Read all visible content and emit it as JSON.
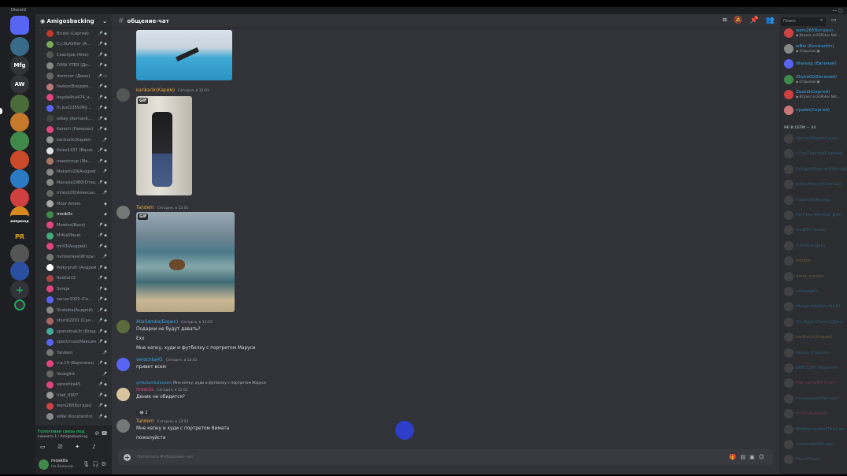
{
  "app": {
    "title": "Discord"
  },
  "window": {
    "controls": "— ◻"
  },
  "servers": [
    {
      "label": "",
      "color": "#5865f2",
      "kind": "home"
    },
    {
      "label": "",
      "color": "#3a6a8a"
    },
    {
      "label": "Mfg",
      "color": "#313338"
    },
    {
      "label": "AW",
      "color": "#313338"
    },
    {
      "label": "",
      "color": "#4a6b3a",
      "badge": true
    },
    {
      "label": "",
      "color": "#c47a2a"
    },
    {
      "label": "",
      "color": "#3f8a4a"
    },
    {
      "label": "",
      "color": "#c94a2a"
    },
    {
      "label": "",
      "color": "#2a7ac4"
    },
    {
      "label": "",
      "color": "#d04040"
    },
    {
      "label": "",
      "color": "#d88a20"
    },
    {
      "label": "ремприходи",
      "color": "#1e1f22"
    },
    {
      "label": "PR",
      "color": "#1e1f22"
    },
    {
      "label": "",
      "color": "#555"
    },
    {
      "label": "",
      "color": "#2a4fa0"
    },
    {
      "label": "+",
      "color": "#313338"
    },
    {
      "label": "",
      "color": "#313338"
    }
  ],
  "guild": {
    "name": "Amigosbacking",
    "dropdown_icon": "chevron-down-icon"
  },
  "voice_members": [
    {
      "name": "Brutel (Сергей)",
      "color": "#c0392b",
      "icons": "🎤̸ ◆"
    },
    {
      "name": "C.J.SLASHer (А...",
      "color": "#7a5",
      "icons": "🎤̸ ◆"
    },
    {
      "name": "Coachjoe (Alex)",
      "color": "#555",
      "icons": "🎤̸ ◆"
    },
    {
      "name": "DIMA YTER (Дн...",
      "color": "#888",
      "icons": "🎤̸ ◆"
    },
    {
      "name": "dremner (Дима)",
      "color": "#666",
      "icons": "🎤̸ ▭"
    },
    {
      "name": "favkov(Владим...",
      "color": "#b77",
      "icons": "🎤̸ ◆"
    },
    {
      "name": "heyda4hu474_a...",
      "color": "#e0457b",
      "icons": "🎤̸ ◆"
    },
    {
      "name": "Ih.Just2355(Му...",
      "color": "#5865f2",
      "icons": "🎤̸ ◆"
    },
    {
      "name": "izikey (RomanK...",
      "color": "#444",
      "icons": "🎤̸ ◆"
    },
    {
      "name": "Karach (Рамазан)",
      "color": "#e0457b",
      "icons": "🎤̸ ◆"
    },
    {
      "name": "karikarik(Карим)",
      "color": "#999",
      "icons": "🎤̸"
    },
    {
      "name": "Koles1437 (Ваня)",
      "color": "#e0e0e0",
      "icons": "🎤̸ ◆"
    },
    {
      "name": "maestroup (Ма...",
      "color": "#a76",
      "icons": "🎤̸ ◆"
    },
    {
      "name": "Makario29(Андрей)",
      "color": "#888",
      "icons": "🎤̸"
    },
    {
      "name": "Marusia1980(Отец)",
      "color": "#888",
      "icons": "🎤̸ ◆"
    },
    {
      "name": "miles100(Алексан...",
      "color": "#666",
      "icons": "🎤̸"
    },
    {
      "name": "Moor Artem",
      "color": "#aaa",
      "icons": "◆"
    },
    {
      "name": "mosk0s",
      "color": "#3f8a4a",
      "icons": "◆",
      "active": true
    },
    {
      "name": "Mowins(Вася)",
      "color": "#e0457b",
      "icons": "🎤̸ ◆"
    },
    {
      "name": "MrKu(Илья)",
      "color": "#4a7",
      "icons": "🎤̸ ◆"
    },
    {
      "name": "mr43(Андрей)",
      "color": "#e0457b",
      "icons": "🎤̸ ◆"
    },
    {
      "name": "nuniserase(Игорь)",
      "color": "#777",
      "icons": "🎤̸"
    },
    {
      "name": "Polkygrutt (Андрей)",
      "color": "#fff",
      "icons": "🎤̸ ◆"
    },
    {
      "name": "Redilani3",
      "color": "#a44",
      "icons": "🎤̸ ◆"
    },
    {
      "name": "Seroja",
      "color": "#e0457b",
      "icons": "🎤̸ ◆"
    },
    {
      "name": "server1000 (Се...",
      "color": "#5865f2",
      "icons": "🎤̸ ◆"
    },
    {
      "name": "Shatoba(Андрей)",
      "color": "#888",
      "icons": "🎤̸ ◆"
    },
    {
      "name": "shurik2201 (Сан...",
      "color": "#a66",
      "icons": "🎤̸ ◆"
    },
    {
      "name": "spanemak3r (Влад...",
      "color": "#4a9",
      "icons": "🎤̸ ◆"
    },
    {
      "name": "spectrmas(Максим)",
      "color": "#5865f2",
      "icons": "🎤̸ ◆"
    },
    {
      "name": "Tandem",
      "color": "#777",
      "icons": "🎤̸"
    },
    {
      "name": "v.a.19 (Вероника)",
      "color": "#e0457b",
      "icons": "🎤̸ ◆"
    },
    {
      "name": "Vazeglist",
      "color": "#666",
      "icons": "🎤̸"
    },
    {
      "name": "verochka45",
      "color": "#e0457b",
      "icons": "🎤̸ ◆"
    },
    {
      "name": "Vlad_9907",
      "color": "#999",
      "icons": "🎤̸ ◆"
    },
    {
      "name": "wers26f(Богдан)",
      "color": "#c44",
      "icons": "🎤̸ ◆"
    },
    {
      "name": "wNw (Konstantin)",
      "color": "#888",
      "icons": "🎤̸ ◆"
    }
  ],
  "voice_panel": {
    "status": "Голосовая связь под",
    "location": "комната 1 / Amigosbacking"
  },
  "user_panel": {
    "name": "mosk0s",
    "status": "На Великой..."
  },
  "channel": {
    "name": "общение-чат"
  },
  "messages": [
    {
      "author": "karikarik(Карим)",
      "author_color": "#e6a93d",
      "time": "Сегодня, в 12:01",
      "gif": true
    },
    {
      "author": "Tandem",
      "author_color": "#e6a93d",
      "time": "Сегодня, в 12:01",
      "gif": true
    },
    {
      "author": "AllaSamka(Борис)",
      "author_color": "#3ba5e4",
      "time": "Сегодня, в 12:02",
      "lines": [
        "Подарки не будут давать?",
        "Exx",
        "Мне кепку, худи и футболку с портретом Маруси"
      ]
    },
    {
      "author": "verochka45",
      "author_color": "#3ba5e4",
      "time": "Сегодня, в 12:02",
      "lines": [
        "привет всем"
      ]
    },
    {
      "reply_to": "@AllaSamka(Борис)",
      "reply_text": "Мне кепку, худи и футболку с портретом Маруси",
      "author": "mosk0s",
      "author_color": "#e0457b",
      "time": "Сегодня, в 12:02",
      "lines": [
        "Деник не обидится?"
      ],
      "reaction": "😂 2"
    },
    {
      "author": "Tandem",
      "author_color": "#e6a93d",
      "time": "Сегодня, в 12:03",
      "lines": [
        "Мне кепку и худи с портретом Вимата",
        "пожалуйста"
      ]
    }
  ],
  "gif_label": "GIF",
  "input": {
    "placeholder": "Написать #общение-чат"
  },
  "search": {
    "placeholder": "Поиск"
  },
  "online_members": [
    {
      "name": "wers26f(Богдан)",
      "sub": "◆ Играет в GGPoker Net...",
      "color": "#3ba5e4",
      "av": "#c44"
    },
    {
      "name": "wNw (Konstantin)",
      "sub": "◆ Отдыхаю ▣",
      "color": "#3ba5e4",
      "av": "#888"
    },
    {
      "name": "Ww/exp (Евгений)",
      "sub": "",
      "color": "#3ba5e4",
      "av": "#5865f2"
    },
    {
      "name": "Zbyka00(Евгений)",
      "sub": "◆ Отдыхаю ▣",
      "color": "#3ba5e4",
      "av": "#3f8a4a"
    },
    {
      "name": "Zezeal(Сергей)",
      "sub": "◆ Играет в GGPoker Net...",
      "color": "#3ba5e4",
      "av": "#d04040"
    },
    {
      "name": "прайм(Сергей)",
      "sub": "",
      "color": "#3ba5e4",
      "av": "#c77"
    }
  ],
  "offline_header": "НЕ В СЕТИ — 33",
  "offline_members": [
    {
      "name": "Bjecar(Мерп(Саша)",
      "color": "#3ba5e4"
    },
    {
      "name": "c7ra(Сергей(Сергей)",
      "color": "#3ba5e4"
    },
    {
      "name": "Jishgpd(Вартаr)(Артур)",
      "color": "#3ba5e4"
    },
    {
      "name": "jekto(Ника)(Сергей)",
      "color": "#3ba5e4"
    },
    {
      "name": "Kogal(К)(Кезар)",
      "color": "#3ba5e4"
    },
    {
      "name": "FinT-the Kei-KLG ДХС",
      "color": "#3ba5e4"
    },
    {
      "name": "chuEP(Сaсма)",
      "color": "#3ba5e4"
    },
    {
      "name": "Candice(Дзе)",
      "color": "#3ba5e4"
    },
    {
      "name": "Denbik",
      "color": "#e6a93d"
    },
    {
      "name": "dima_money",
      "color": "#e6a93d"
    },
    {
      "name": "ar(hubgk)",
      "color": "#3ba5e4"
    },
    {
      "name": "Hungrubb(Kyrylo)(Ю",
      "color": "#3ba5e4"
    },
    {
      "name": "IYv(Aapr)(Тимо)(Деш",
      "color": "#3ba5e4"
    },
    {
      "name": "karikarik(Карим)",
      "color": "#e6a93d"
    },
    {
      "name": "kessle (Сергео)",
      "color": "#3ba5e4"
    },
    {
      "name": "LWFLUXH (Каролн)",
      "color": "#3ba5e4"
    },
    {
      "name": "Mansarka89(Олег)",
      "color": "#e0457b"
    },
    {
      "name": "moneyberd(Артем)",
      "color": "#3ba5e4"
    },
    {
      "name": "mr43(Андрей)",
      "color": "#e0457b"
    },
    {
      "name": "NetBunnysNo(Ти)(Сер",
      "color": "#3ba5e4"
    },
    {
      "name": "nationdeb(Игорь)",
      "color": "#3ba5e4"
    },
    {
      "name": "Plan(Плор)",
      "color": "#3ba5e4"
    }
  ]
}
